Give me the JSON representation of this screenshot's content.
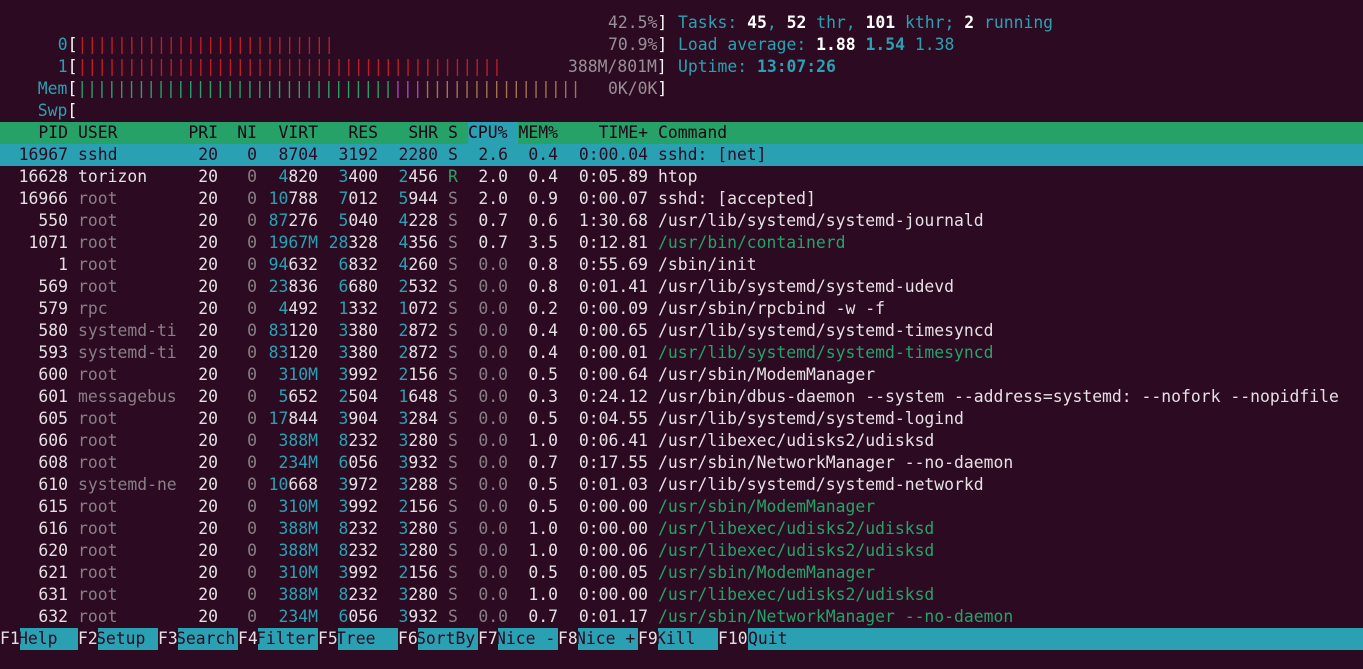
{
  "meters": {
    "cpu0": {
      "label": "0",
      "bars": "||||||||||||||||||||||||||",
      "percent": "42.5%",
      "value": 0.425
    },
    "cpu1": {
      "label": "1",
      "bars": "|||||||||||||||||||||||||||||||||||||||||||",
      "percent": "70.9%",
      "value": 0.709
    },
    "mem": {
      "label": "Mem",
      "bars_green": "||||||||||||||||||||||||||||||||",
      "bars_mag": "|||",
      "bars_ylw": "||||||||||||||||",
      "text": "388M/801M"
    },
    "swp": {
      "label": "Swp",
      "text": "0K/0K"
    }
  },
  "stats": {
    "tasks_label": "Tasks: ",
    "tasks": "45",
    "thr": "52",
    "thr_label": " thr, ",
    "kthr": "101",
    "kthr_label": " kthr; ",
    "running": "2",
    "running_label": " running",
    "load_label": "Load average: ",
    "load1": "1.88",
    "load5": "1.54",
    "load15": "1.38",
    "uptime_label": "Uptime: ",
    "uptime": "13:07:26"
  },
  "columns": [
    "PID",
    "USER",
    "PRI",
    "NI",
    "VIRT",
    "RES",
    "SHR",
    "S",
    "CPU%",
    "MEM%",
    "TIME+",
    "Command"
  ],
  "processes": [
    {
      "pid": "16967",
      "user": "sshd",
      "pri": "20",
      "ni": "0",
      "virt": "8704",
      "res": "3192",
      "shr": "2280",
      "s": "S",
      "cpu": "2.6",
      "mem": "0.4",
      "time": "0:00.04",
      "cmd": "sshd: [net]",
      "thread": false
    },
    {
      "pid": "16628",
      "user": "torizon",
      "pri": "20",
      "ni": "0",
      "virt": "4820",
      "res": "3400",
      "shr": "2456",
      "s": "R",
      "cpu": "2.0",
      "mem": "0.4",
      "time": "0:05.89",
      "cmd": "htop",
      "thread": false
    },
    {
      "pid": "16966",
      "user": "root",
      "pri": "20",
      "ni": "0",
      "virt": "10788",
      "res": "7012",
      "shr": "5944",
      "s": "S",
      "cpu": "2.0",
      "mem": "0.9",
      "time": "0:00.07",
      "cmd": "sshd: [accepted]",
      "thread": false
    },
    {
      "pid": "550",
      "user": "root",
      "pri": "20",
      "ni": "0",
      "virt": "87276",
      "res": "5040",
      "shr": "4228",
      "s": "S",
      "cpu": "0.7",
      "mem": "0.6",
      "time": "1:30.68",
      "cmd": "/usr/lib/systemd/systemd-journald",
      "thread": false
    },
    {
      "pid": "1071",
      "user": "root",
      "pri": "20",
      "ni": "0",
      "virt": "1967M",
      "res": "28328",
      "shr": "4356",
      "s": "S",
      "cpu": "0.7",
      "mem": "3.5",
      "time": "0:12.81",
      "cmd": "/usr/bin/containerd",
      "thread": true
    },
    {
      "pid": "1",
      "user": "root",
      "pri": "20",
      "ni": "0",
      "virt": "94632",
      "res": "6832",
      "shr": "4260",
      "s": "S",
      "cpu": "0.0",
      "mem": "0.8",
      "time": "0:55.69",
      "cmd": "/sbin/init",
      "thread": false
    },
    {
      "pid": "569",
      "user": "root",
      "pri": "20",
      "ni": "0",
      "virt": "23836",
      "res": "6680",
      "shr": "2532",
      "s": "S",
      "cpu": "0.0",
      "mem": "0.8",
      "time": "0:01.41",
      "cmd": "/usr/lib/systemd/systemd-udevd",
      "thread": false
    },
    {
      "pid": "579",
      "user": "rpc",
      "pri": "20",
      "ni": "0",
      "virt": "4492",
      "res": "1332",
      "shr": "1072",
      "s": "S",
      "cpu": "0.0",
      "mem": "0.2",
      "time": "0:00.09",
      "cmd": "/usr/sbin/rpcbind -w -f",
      "thread": false
    },
    {
      "pid": "580",
      "user": "systemd-ti",
      "pri": "20",
      "ni": "0",
      "virt": "83120",
      "res": "3380",
      "shr": "2872",
      "s": "S",
      "cpu": "0.0",
      "mem": "0.4",
      "time": "0:00.65",
      "cmd": "/usr/lib/systemd/systemd-timesyncd",
      "thread": false
    },
    {
      "pid": "593",
      "user": "systemd-ti",
      "pri": "20",
      "ni": "0",
      "virt": "83120",
      "res": "3380",
      "shr": "2872",
      "s": "S",
      "cpu": "0.0",
      "mem": "0.4",
      "time": "0:00.01",
      "cmd": "/usr/lib/systemd/systemd-timesyncd",
      "thread": true
    },
    {
      "pid": "600",
      "user": "root",
      "pri": "20",
      "ni": "0",
      "virt": "310M",
      "res": "3992",
      "shr": "2156",
      "s": "S",
      "cpu": "0.0",
      "mem": "0.5",
      "time": "0:00.64",
      "cmd": "/usr/sbin/ModemManager",
      "thread": false
    },
    {
      "pid": "601",
      "user": "messagebus",
      "pri": "20",
      "ni": "0",
      "virt": "5652",
      "res": "2504",
      "shr": "1648",
      "s": "S",
      "cpu": "0.0",
      "mem": "0.3",
      "time": "0:24.12",
      "cmd": "/usr/bin/dbus-daemon --system --address=systemd: --nofork --nopidfile",
      "thread": false
    },
    {
      "pid": "605",
      "user": "root",
      "pri": "20",
      "ni": "0",
      "virt": "17844",
      "res": "3904",
      "shr": "3284",
      "s": "S",
      "cpu": "0.0",
      "mem": "0.5",
      "time": "0:04.55",
      "cmd": "/usr/lib/systemd/systemd-logind",
      "thread": false
    },
    {
      "pid": "606",
      "user": "root",
      "pri": "20",
      "ni": "0",
      "virt": "388M",
      "res": "8232",
      "shr": "3280",
      "s": "S",
      "cpu": "0.0",
      "mem": "1.0",
      "time": "0:06.41",
      "cmd": "/usr/libexec/udisks2/udisksd",
      "thread": false
    },
    {
      "pid": "608",
      "user": "root",
      "pri": "20",
      "ni": "0",
      "virt": "234M",
      "res": "6056",
      "shr": "3932",
      "s": "S",
      "cpu": "0.0",
      "mem": "0.7",
      "time": "0:17.55",
      "cmd": "/usr/sbin/NetworkManager --no-daemon",
      "thread": false
    },
    {
      "pid": "610",
      "user": "systemd-ne",
      "pri": "20",
      "ni": "0",
      "virt": "10668",
      "res": "3972",
      "shr": "3288",
      "s": "S",
      "cpu": "0.0",
      "mem": "0.5",
      "time": "0:01.03",
      "cmd": "/usr/lib/systemd/systemd-networkd",
      "thread": false
    },
    {
      "pid": "615",
      "user": "root",
      "pri": "20",
      "ni": "0",
      "virt": "310M",
      "res": "3992",
      "shr": "2156",
      "s": "S",
      "cpu": "0.0",
      "mem": "0.5",
      "time": "0:00.00",
      "cmd": "/usr/sbin/ModemManager",
      "thread": true
    },
    {
      "pid": "616",
      "user": "root",
      "pri": "20",
      "ni": "0",
      "virt": "388M",
      "res": "8232",
      "shr": "3280",
      "s": "S",
      "cpu": "0.0",
      "mem": "1.0",
      "time": "0:00.00",
      "cmd": "/usr/libexec/udisks2/udisksd",
      "thread": true
    },
    {
      "pid": "620",
      "user": "root",
      "pri": "20",
      "ni": "0",
      "virt": "388M",
      "res": "8232",
      "shr": "3280",
      "s": "S",
      "cpu": "0.0",
      "mem": "1.0",
      "time": "0:00.06",
      "cmd": "/usr/libexec/udisks2/udisksd",
      "thread": true
    },
    {
      "pid": "621",
      "user": "root",
      "pri": "20",
      "ni": "0",
      "virt": "310M",
      "res": "3992",
      "shr": "2156",
      "s": "S",
      "cpu": "0.0",
      "mem": "0.5",
      "time": "0:00.05",
      "cmd": "/usr/sbin/ModemManager",
      "thread": true
    },
    {
      "pid": "631",
      "user": "root",
      "pri": "20",
      "ni": "0",
      "virt": "388M",
      "res": "8232",
      "shr": "3280",
      "s": "S",
      "cpu": "0.0",
      "mem": "1.0",
      "time": "0:00.00",
      "cmd": "/usr/libexec/udisks2/udisksd",
      "thread": true
    },
    {
      "pid": "632",
      "user": "root",
      "pri": "20",
      "ni": "0",
      "virt": "234M",
      "res": "6056",
      "shr": "3932",
      "s": "S",
      "cpu": "0.0",
      "mem": "0.7",
      "time": "0:01.17",
      "cmd": "/usr/sbin/NetworkManager --no-daemon",
      "thread": true
    }
  ],
  "fkeys": [
    {
      "key": "F1",
      "label": "Help"
    },
    {
      "key": "F2",
      "label": "Setup"
    },
    {
      "key": "F3",
      "label": "Search"
    },
    {
      "key": "F4",
      "label": "Filter"
    },
    {
      "key": "F5",
      "label": "Tree"
    },
    {
      "key": "F6",
      "label": "SortBy"
    },
    {
      "key": "F7",
      "label": "Nice -"
    },
    {
      "key": "F8",
      "label": "Nice +"
    },
    {
      "key": "F9",
      "label": "Kill"
    },
    {
      "key": "F10",
      "label": "Quit"
    }
  ],
  "colors": {
    "bg": "#2c0b22",
    "header": "#26a269",
    "selected": "#2aa1b3",
    "thread_cmd": "#26a269"
  }
}
